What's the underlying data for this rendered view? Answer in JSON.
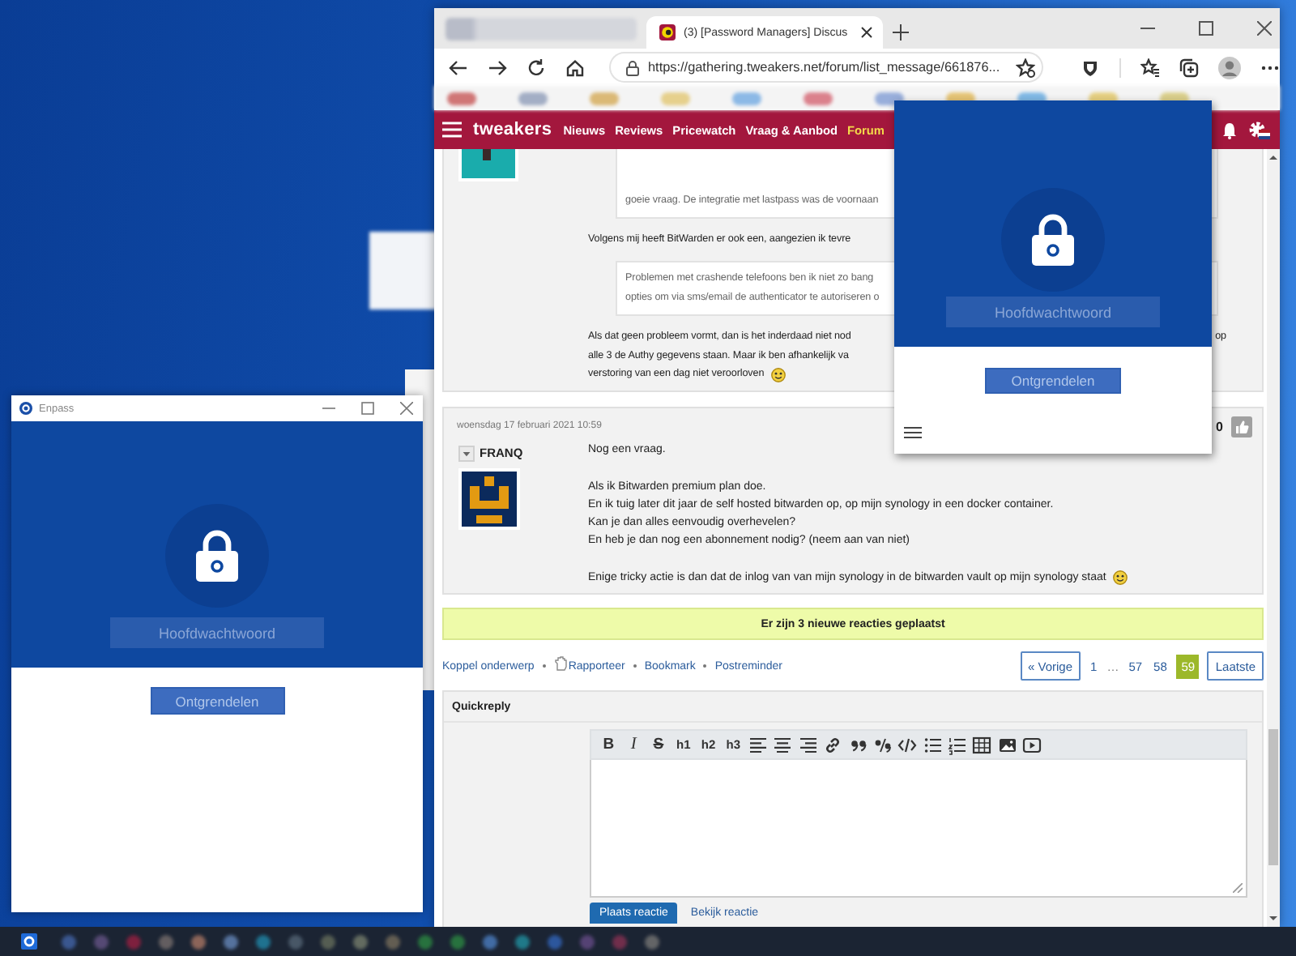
{
  "browser": {
    "tabs": [
      {
        "title": "(3) [Password Managers] Discus",
        "selected": true
      }
    ],
    "url": "https://gathering.tweakers.net/forum/list_message/661876..."
  },
  "site_nav": {
    "logo": "tweakers",
    "items": [
      {
        "label": "Nieuws",
        "selected": false
      },
      {
        "label": "Reviews",
        "selected": false
      },
      {
        "label": "Pricewatch",
        "selected": false
      },
      {
        "label": "Vraag & Aanbod",
        "selected": false
      },
      {
        "label": "Forum",
        "selected": true
      }
    ]
  },
  "posts": [
    {
      "blocks": [
        {
          "kind": "quote",
          "lines": [
            "goeie vraag. De integratie met lastpass was de voornaan"
          ]
        },
        {
          "kind": "paragraph",
          "lines": [
            "Volgens mij heeft BitWarden er ook een, aangezien ik tevre"
          ]
        },
        {
          "kind": "quote",
          "lines": [
            "Problemen met crashende telefoons ben ik niet zo bang",
            "opties om via sms/email de authenticator te autoriseren o"
          ]
        },
        {
          "kind": "paragraph",
          "lines": [
            "Als dat geen probleem vormt, dan is het inderdaad niet nod",
            "alle 3 de Authy gegevens staan. Maar ik ben afhankelijk va",
            "verstoring van een dag niet veroorloven"
          ],
          "side_text": "op",
          "smiley": true
        }
      ]
    },
    {
      "date": "woensdag 17 februari 2021 10:59",
      "author": "FRANQ",
      "score": "0",
      "blocks": [
        {
          "kind": "paragraph",
          "lines": [
            "Nog een vraag."
          ]
        },
        {
          "kind": "paragraph",
          "lines": [
            "Als ik Bitwarden premium plan doe.",
            "En ik tuig later dit jaar de self hosted bitwarden op, op mijn synology in een docker container.",
            "Kan je dan alles eenvoudig overhevelen?",
            "En heb je dan nog een abonnement nodig? (neem aan van niet)"
          ]
        },
        {
          "kind": "paragraph",
          "lines": [
            "Enige tricky actie is dan dat de inlog van van mijn synology in de bitwarden vault op mijn synology staat"
          ],
          "smiley": true
        }
      ]
    }
  ],
  "notice": "Er zijn 3 nieuwe reacties geplaatst",
  "topic_links": [
    {
      "label": "Koppel onderwerp",
      "kind": "plain"
    },
    {
      "label": "Rapporteer",
      "kind": "report"
    },
    {
      "label": "Bookmark",
      "kind": "plain"
    },
    {
      "label": "Postreminder",
      "kind": "plain"
    }
  ],
  "pagination": {
    "prev": "« Vorige",
    "pages": [
      {
        "label": "1",
        "kind": "page",
        "selected": false
      },
      {
        "label": "…",
        "kind": "gap"
      },
      {
        "label": "57",
        "kind": "page",
        "selected": false
      },
      {
        "label": "58",
        "kind": "page",
        "selected": false
      },
      {
        "label": "59",
        "kind": "page",
        "selected": true
      }
    ],
    "last": "Laatste"
  },
  "quickreply": {
    "title": "Quickreply",
    "format_buttons": [
      {
        "label": "B",
        "kind": "bold"
      },
      {
        "label": "I",
        "kind": "italic"
      },
      {
        "label": "S",
        "kind": "strike"
      },
      {
        "label": "h1",
        "kind": "heading"
      },
      {
        "label": "h2",
        "kind": "heading"
      },
      {
        "label": "h3",
        "kind": "heading"
      }
    ],
    "tabs": [
      {
        "label": "Plaats reactie",
        "selected": true
      },
      {
        "label": "Bekijk reactie",
        "selected": false
      }
    ]
  },
  "enpass_window": {
    "title": "Enpass",
    "placeholder": "Hoofdwachtwoord",
    "button": "Ontgrendelen"
  },
  "enpass_popup": {
    "placeholder": "Hoofdwachtwoord",
    "button": "Ontgrendelen"
  }
}
